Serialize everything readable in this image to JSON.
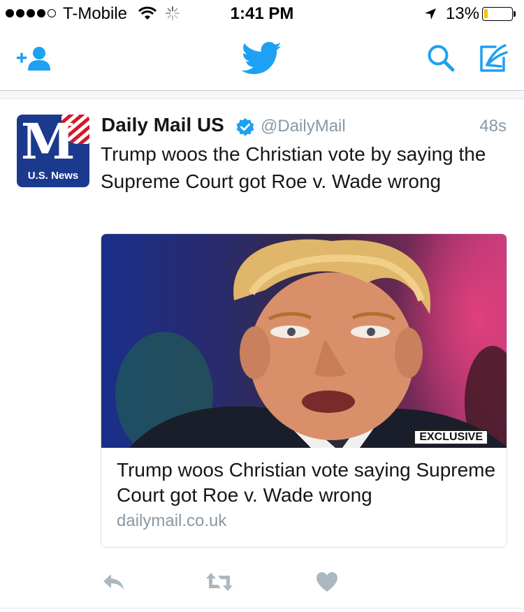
{
  "status_bar": {
    "carrier": "T-Mobile",
    "signal_bars": 4,
    "signal_max": 5,
    "time": "1:41 PM",
    "battery_percent": "13%",
    "battery_level": 0.13,
    "battery_color": "#f5c400"
  },
  "nav": {
    "icons": [
      "add-user-icon",
      "twitter-bird-icon",
      "search-icon",
      "compose-icon"
    ],
    "accent_color": "#1da1f2"
  },
  "tweet": {
    "display_name": "Daily Mail US",
    "verified": true,
    "handle": "@DailyMail",
    "timestamp": "48s",
    "avatar_caption": "U.S. News",
    "avatar_logo_text": "M",
    "text": "Trump woos the Christian vote by saying the Supreme Court got Roe v. Wade wrong",
    "card": {
      "badge": "EXCLUSIVE",
      "title": "Trump woos Christian vote saying Supreme Court got Roe v. Wade wrong",
      "domain": "dailymail.co.uk"
    },
    "actions": [
      "reply-icon",
      "retweet-icon",
      "like-icon"
    ]
  }
}
